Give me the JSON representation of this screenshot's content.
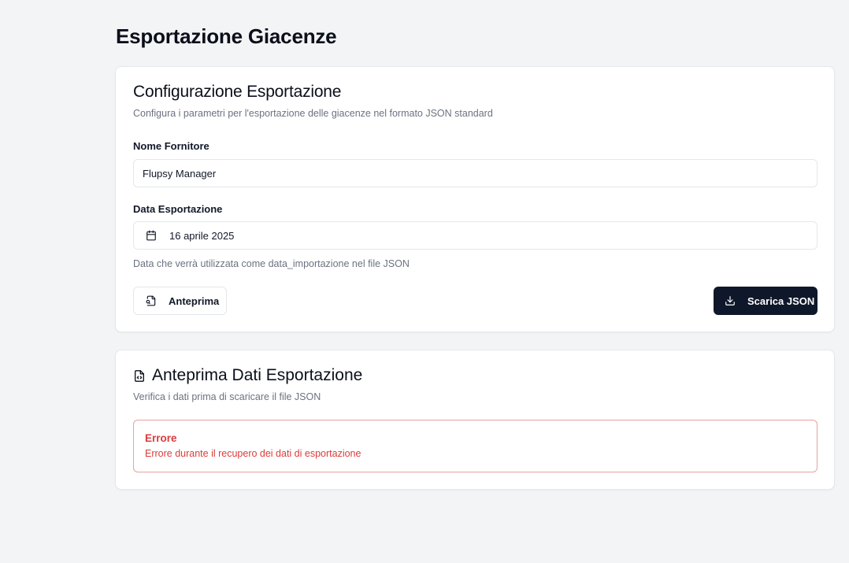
{
  "page": {
    "title": "Esportazione Giacenze"
  },
  "config_card": {
    "title": "Configurazione Esportazione",
    "description": "Configura i parametri per l'esportazione delle giacenze nel formato JSON standard",
    "supplier_label": "Nome Fornitore",
    "supplier_value": "Flupsy Manager",
    "date_label": "Data Esportazione",
    "date_value": "16 aprile 2025",
    "date_icon": "calendar-icon",
    "date_hint": "Data che verrà utilizzata come data_importazione nel file JSON",
    "preview_button": "Anteprima",
    "preview_button_icon": "file-search-icon",
    "download_button": "Scarica JSON",
    "download_button_icon": "download-icon",
    "download_button_color": "#0f172a"
  },
  "preview_card": {
    "title": "Anteprima Dati Esportazione",
    "title_icon": "file-code-icon",
    "description": "Verifica i dati prima di scaricare il file JSON",
    "error_title": "Errore",
    "error_message": "Errore durante il recupero dei dati di esportazione",
    "error_color": "#dc3b3b"
  }
}
